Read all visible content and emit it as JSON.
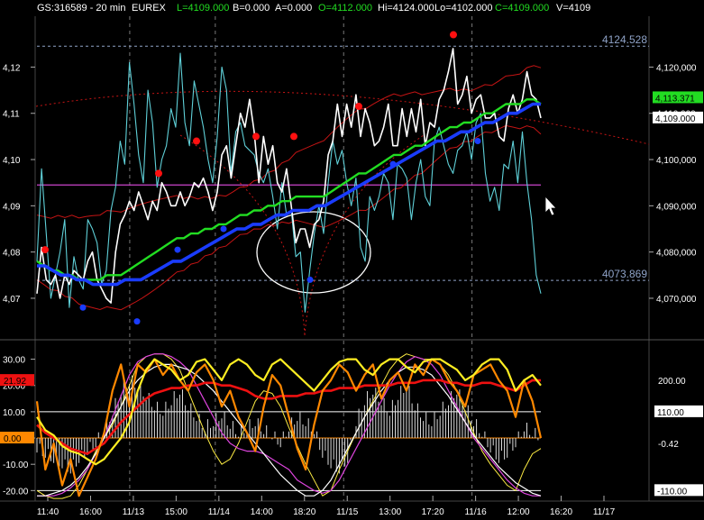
{
  "header": {
    "symbol": "GS:316589 - 20 min",
    "exchange": "EUREX",
    "last": "L=4109.000",
    "bid": "B=0.000",
    "ask": "A=0.000",
    "open": "O=4112.000",
    "high": "Hi=4124.000",
    "low": "Lo=4102.000",
    "close": "C=4109.000",
    "volume": "V=4109"
  },
  "colors": {
    "background": "#000000",
    "price": "#ffffff",
    "cyan_line": "#5fd0d8",
    "green_ma": "#22dd22",
    "blue_ma": "#1a3cff",
    "envelope": "#c41414",
    "magenta_level": "#cc44cc",
    "guide": "#8fa3c8",
    "red_dot": "#ff1010",
    "blue_dot": "#1a3cff",
    "yellow": "#ffee22",
    "orange": "#ff8800",
    "red_osc": "#ee1111"
  },
  "chart_data": [
    {
      "type": "line",
      "panel": "price",
      "x_ticks": [
        "11:40",
        "16:00",
        "11/13",
        "15:00",
        "11/14",
        "14:00",
        "18:20",
        "11/15",
        "13:00",
        "17:20",
        "11/16",
        "12:00",
        "16:20",
        "11/17"
      ],
      "y_ticks": [
        "4,12",
        "4,11",
        "4,10",
        "4,09",
        "4,08",
        "4,07"
      ],
      "y_ticks_right": [
        "4,120,000",
        "4,110,000",
        "4,100,000",
        "4,090,000",
        "4,080,000",
        "4,070,000"
      ],
      "ylim": [
        4062,
        4131
      ],
      "guide_levels": [
        {
          "label": "4124.528",
          "value": 4124.528
        },
        {
          "label": "4073.869",
          "value": 4073.869
        }
      ],
      "horizontal_line": 4094.5,
      "badges": [
        {
          "label": "4,113.371",
          "value": 4113.371,
          "color": "#22dd22"
        },
        {
          "label": "4,109.000",
          "value": 4109.0,
          "color": "#ffffff"
        }
      ],
      "series": [
        {
          "values": [
            4071,
            4081,
            4074,
            4073,
            4075,
            4070,
            4075,
            4073,
            4076,
            4075,
            4074,
            4078,
            4080,
            4074,
            4072,
            4070,
            4069,
            4080,
            4086,
            4088,
            4091,
            4089,
            4093,
            4090,
            4087,
            4091,
            4089,
            4095,
            4093,
            4090,
            4090,
            4093,
            4090,
            4092,
            4095,
            4094,
            4096,
            4093,
            4089,
            4093,
            4101,
            4103,
            4096,
            4103,
            4110,
            4107,
            4113,
            4106,
            4095,
            4105,
            4099,
            4103,
            4095,
            4093,
            4098,
            4090,
            4082,
            4085,
            4085,
            4081,
            4086,
            4087,
            4091,
            4101,
            4104,
            4112,
            4105,
            4112,
            4107,
            4114,
            4105,
            4111,
            4108,
            4103,
            4104,
            4107,
            4112,
            4103,
            4103,
            4111,
            4105,
            4111,
            4106,
            4113,
            4103,
            4108,
            4107,
            4113,
            4115,
            4119,
            4124,
            4112,
            4114,
            4118,
            4110,
            4113,
            4114,
            4109,
            4109,
            4110,
            4105,
            4104,
            4111,
            4114,
            4110,
            4113,
            4119,
            4114,
            4113,
            4109
          ]
        },
        {
          "values": [
            4078,
            4098,
            4084,
            4070,
            4075,
            4080,
            4087,
            4068,
            4079,
            4074,
            4072,
            4087,
            4085,
            4082,
            4073,
            4076,
            4089,
            4094,
            4104,
            4099,
            4121,
            4112,
            4101,
            4095,
            4115,
            4108,
            4094,
            4100,
            4103,
            4111,
            4107,
            4123,
            4108,
            4103,
            4117,
            4112,
            4107,
            4100,
            4095,
            4105,
            4120,
            4115,
            4097,
            4106,
            4108,
            4103,
            4102,
            4101,
            4097,
            4095,
            4098,
            4092,
            4085,
            4095,
            4088,
            4089,
            4079,
            4080,
            4067,
            4076,
            4084,
            4090,
            4084,
            4095,
            4104,
            4099,
            4102,
            4095,
            4090,
            4096,
            4081,
            4078,
            4092,
            4089,
            4092,
            4097,
            4095,
            4087,
            4099,
            4098,
            4096,
            4087,
            4095,
            4100,
            4092,
            4090,
            4104,
            4107,
            4103,
            4099,
            4097,
            4102,
            4103,
            4106,
            4100,
            4108,
            4110,
            4097,
            4091,
            4094,
            4089,
            4099,
            4098,
            4104,
            4095,
            4106,
            4095,
            4087,
            4075,
            4071
          ]
        },
        {
          "values": [
            4078,
            4077,
            4076,
            4076,
            4075,
            4075,
            4074,
            4074,
            4074,
            4074,
            4075,
            4075,
            4075,
            4076,
            4077,
            4078,
            4079,
            4080,
            4081,
            4082,
            4083,
            4083,
            4084,
            4084,
            4085,
            4085,
            4086,
            4086,
            4087,
            4088,
            4088,
            4089,
            4089,
            4090,
            4090,
            4091,
            4091,
            4092,
            4092,
            4092,
            4092,
            4092,
            4093,
            4094,
            4095,
            4096,
            4097,
            4097,
            4098,
            4099,
            4100,
            4101,
            4101,
            4102,
            4103,
            4103,
            4104,
            4105,
            4106,
            4107,
            4107,
            4108,
            4108,
            4109,
            4110,
            4110,
            4111,
            4112,
            4112,
            4112,
            4113,
            4113,
            4112
          ]
        },
        {
          "values": [
            4077,
            4077,
            4076,
            4075,
            4075,
            4074,
            4074,
            4073,
            4073,
            4073,
            4073,
            4074,
            4074,
            4074,
            4075,
            4076,
            4077,
            4078,
            4078,
            4079,
            4080,
            4081,
            4082,
            4083,
            4084,
            4085,
            4085,
            4086,
            4086,
            4087,
            4088,
            4088,
            4089,
            4089,
            4089,
            4090,
            4090,
            4091,
            4092,
            4093,
            4094,
            4095,
            4096,
            4097,
            4098,
            4099,
            4100,
            4101,
            4102,
            4103,
            4104,
            4104,
            4105,
            4106,
            4106,
            4107,
            4108,
            4108,
            4109,
            4110,
            4110,
            4111,
            4112,
            4112
          ]
        }
      ],
      "red_dots": [
        4080.5,
        4097,
        4104,
        4105,
        4105,
        4111.5,
        4127
      ],
      "blue_dots": [
        4068,
        4065,
        4080.5,
        4085,
        4074,
        4099,
        4104
      ]
    },
    {
      "type": "line",
      "panel": "oscillator",
      "y_ticks": [
        "30.00",
        "20.00",
        "10.00",
        "0.00",
        "-10.00",
        "-20.00"
      ],
      "y_ticks_right": [
        "200.00",
        "-0.42"
      ],
      "ylim": [
        -24,
        35
      ],
      "badges": [
        {
          "label": "21.92",
          "value": 21.92,
          "color": "#ee1111"
        },
        {
          "label": "0.00",
          "value": 0.0,
          "color": "#ff8800"
        },
        {
          "label": "110.00",
          "value": 10.0,
          "color": "#ffffff"
        },
        {
          "label": "-110.00",
          "value": -20.0,
          "color": "#ffffff"
        }
      ],
      "reference_lines": [
        10,
        0,
        -20
      ],
      "series": [
        {
          "values": [
            8,
            3,
            1,
            -3,
            -5,
            -6,
            -8,
            -10,
            -8,
            -4,
            0,
            6,
            18,
            26,
            30,
            28,
            26,
            22,
            24,
            29,
            30,
            26,
            22,
            28,
            30,
            28,
            24,
            22,
            28,
            30,
            27,
            24,
            21,
            18,
            22,
            26,
            29,
            30,
            30,
            26,
            24,
            28,
            30,
            30,
            27,
            25,
            29,
            30,
            30,
            28,
            26,
            22,
            24,
            28,
            30,
            30,
            26,
            18,
            22,
            24,
            20
          ]
        },
        {
          "values": [
            14,
            -12,
            -2,
            -18,
            -8,
            -22,
            -15,
            -8,
            2,
            18,
            28,
            12,
            28,
            25,
            30,
            24,
            28,
            22,
            18,
            25,
            28,
            22,
            12,
            18,
            8,
            2,
            -5,
            12,
            24,
            20,
            8,
            -4,
            -12,
            5,
            18,
            22,
            28,
            25,
            18,
            24,
            28,
            15,
            22,
            25,
            18,
            28,
            24,
            30,
            28,
            22,
            18,
            12,
            24,
            26,
            28,
            22,
            18,
            8,
            22,
            14,
            0
          ]
        },
        {
          "values": [
            5,
            2,
            0,
            -2,
            -4,
            -5,
            -6,
            -4,
            -2,
            2,
            6,
            9,
            12,
            15,
            17,
            18,
            19,
            19,
            20,
            20,
            21,
            21,
            20,
            20,
            19,
            18,
            16,
            15,
            15,
            16,
            16,
            16,
            17,
            17,
            18,
            18,
            19,
            19,
            19,
            20,
            20,
            20,
            20,
            21,
            21,
            21,
            22,
            22,
            22,
            21,
            21,
            20,
            20,
            21,
            21,
            20,
            19,
            18,
            20,
            22,
            21.92
          ]
        },
        {
          "values": [
            -20,
            -22,
            -23,
            -23,
            -22,
            -18,
            -12,
            -5,
            0,
            5,
            12,
            20,
            28,
            31,
            32,
            32,
            30,
            26,
            18,
            10,
            2,
            -5,
            -10,
            -8,
            -2,
            6,
            14,
            18,
            17,
            12,
            4,
            -3,
            -10,
            -16,
            -22,
            -20,
            -12,
            -5,
            2,
            8,
            14,
            20,
            26,
            30,
            32,
            31,
            30,
            30,
            28,
            24,
            18,
            10,
            2,
            -5,
            -10,
            -14,
            -18,
            -20,
            -12,
            -6,
            -4
          ]
        },
        {
          "values": [
            -22,
            -22,
            -22,
            -21,
            -19,
            -16,
            -12,
            -6,
            0,
            8,
            16,
            24,
            29,
            31,
            32,
            32,
            31,
            29,
            26,
            20,
            14,
            8,
            2,
            -2,
            -4,
            -5,
            -5,
            -6,
            -8,
            -10,
            -12,
            -16,
            -18,
            -20,
            -21,
            -20,
            -16,
            -10,
            -4,
            2,
            8,
            14,
            20,
            25,
            29,
            31,
            30,
            28,
            24,
            18,
            12,
            6,
            0,
            -4,
            -8,
            -12,
            -16,
            -19,
            -21,
            -22,
            -22
          ]
        },
        {
          "values": [
            -22,
            -22,
            -21,
            -20,
            -18,
            -15,
            -11,
            -6,
            0,
            6,
            12,
            18,
            22,
            25,
            27,
            28,
            28,
            27,
            26,
            24,
            21,
            18,
            14,
            10,
            6,
            2,
            -2,
            -6,
            -10,
            -14,
            -17,
            -20,
            -22,
            -22,
            -20,
            -16,
            -10,
            -4,
            2,
            8,
            13,
            18,
            22,
            25,
            27,
            27,
            26,
            24,
            20,
            16,
            11,
            6,
            1,
            -3,
            -7,
            -11,
            -14,
            -17,
            -19,
            -21,
            -22
          ]
        },
        {
          "values": [
            -4,
            -6,
            -8,
            -10,
            -12,
            -8,
            -5,
            -2,
            3,
            10,
            18,
            22,
            20,
            16,
            12,
            10,
            14,
            18,
            12,
            8,
            4,
            6,
            9,
            5,
            2,
            4,
            6,
            3,
            1,
            -2,
            4,
            8,
            6,
            3,
            -6,
            -10,
            -12,
            -8,
            6,
            14,
            18,
            14,
            10,
            16,
            20,
            12,
            8,
            6,
            10,
            14,
            18,
            12,
            6,
            2,
            -4,
            -8,
            -6,
            -2,
            4,
            2,
            0
          ]
        }
      ]
    }
  ]
}
